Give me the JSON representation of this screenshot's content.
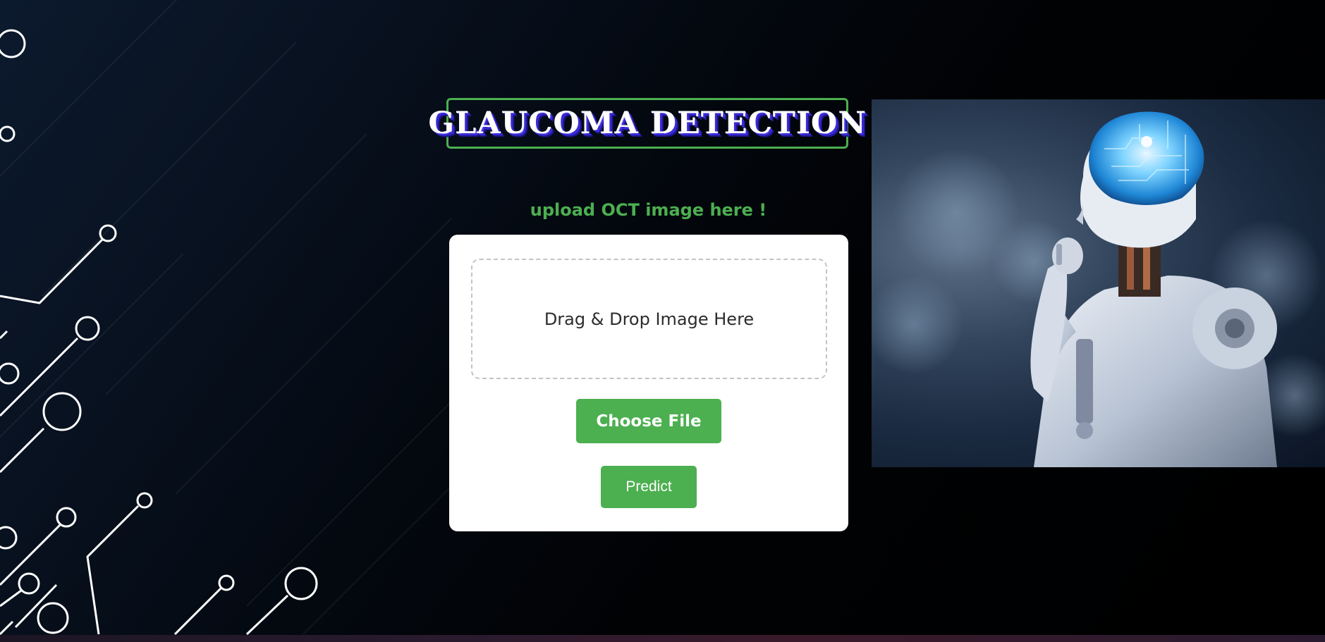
{
  "header": {
    "title": "GLAUCOMA DETECTION"
  },
  "upload": {
    "caption": "upload OCT image here !",
    "dropzone_text": "Drag & Drop Image Here",
    "choose_file_label": "Choose File",
    "predict_label": "Predict"
  },
  "illustration": {
    "icon": "robot-thinking-icon"
  },
  "colors": {
    "accent": "#4caf50",
    "title_shadow": "#3b2bd6",
    "background": "#000000",
    "card": "#ffffff"
  }
}
